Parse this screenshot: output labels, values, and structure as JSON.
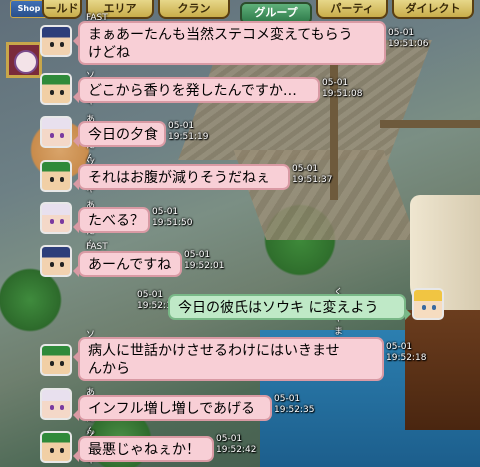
{
  "shop": {
    "label": "Shop"
  },
  "tabs": [
    {
      "label": "ールド",
      "active": false
    },
    {
      "label": "エリア",
      "active": false
    },
    {
      "label": "クラン",
      "active": false
    },
    {
      "label": "グループ",
      "active": true
    },
    {
      "label": "パーティ",
      "active": false
    },
    {
      "label": "ダイレクト",
      "active": false
    }
  ],
  "messages": [
    {
      "sender": "FAST",
      "avatar": "blue-hair-avatar",
      "text1": "まぁあーたんも当然ステコメ変えてもらう",
      "text2": "けどね",
      "date": "05-01",
      "time": "19:51:06"
    },
    {
      "sender": "ソウキ",
      "avatar": "green-hat-avatar",
      "text1": "どこから香りを発したんですか…",
      "text2": "",
      "date": "05-01",
      "time": "19:51:08"
    },
    {
      "sender": "あーたん",
      "avatar": "white-hair-avatar",
      "text1": "今日の夕食",
      "text2": "",
      "date": "05-01",
      "time": "19:51:19"
    },
    {
      "sender": "ソウキ",
      "avatar": "green-hat-avatar",
      "text1": "それはお腹が減りそうだねぇ",
      "text2": "",
      "date": "05-01",
      "time": "19:51:37"
    },
    {
      "sender": "あーたん",
      "avatar": "white-hair-avatar",
      "text1": "たべる？",
      "text2": "",
      "date": "05-01",
      "time": "19:51:50"
    },
    {
      "sender": "FAST",
      "avatar": "blue-hair-avatar",
      "text1": "あーんですね",
      "text2": "",
      "date": "05-01",
      "time": "19:52:01"
    },
    {
      "sender": "くるやまさん",
      "avatar": "blond-hair-avatar",
      "text1": "今日の彼氏はソウキ に変えよう",
      "text2": "",
      "date": "05-01",
      "time": "19:52:11"
    },
    {
      "sender": "ソウキ",
      "avatar": "green-hat-avatar",
      "text1": "病人に世話かけさせるわけにはいきませ",
      "text2": "んから",
      "date": "05-01",
      "time": "19:52:18"
    },
    {
      "sender": "あーたん",
      "avatar": "white-hair-avatar",
      "text1": "インフル増し増しであげる",
      "text2": "",
      "date": "05-01",
      "time": "19:52:35"
    },
    {
      "sender": "ソウキ",
      "avatar": "green-hat-avatar",
      "text1": "最悪じゃねぇか！",
      "text2": "",
      "date": "05-01",
      "time": "19:52:42"
    }
  ]
}
